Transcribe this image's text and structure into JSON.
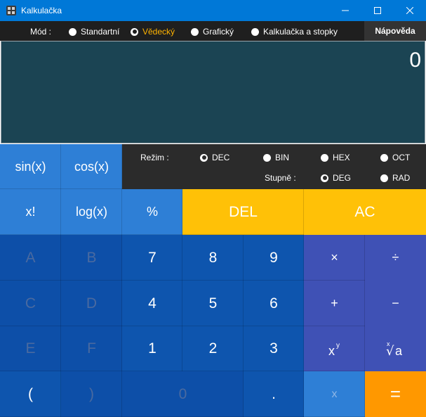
{
  "window": {
    "title": "Kalkulačka"
  },
  "modebar": {
    "label": "Mód :",
    "options": [
      "Standartní",
      "Vědecký",
      "Grafický",
      "Kalkulačka a stopky"
    ],
    "selected": "Vědecký",
    "help_label": "Nápověda"
  },
  "display": {
    "value": "0"
  },
  "regime": {
    "label": "Režim :",
    "options": [
      "DEC",
      "BIN",
      "HEX",
      "OCT"
    ],
    "selected": "DEC"
  },
  "degrees": {
    "label": "Stupně :",
    "options": [
      "DEG",
      "RAD"
    ],
    "selected": "DEG"
  },
  "keys": {
    "sin": "sin(x)",
    "cos": "cos(x)",
    "fact": "x!",
    "log": "log(x)",
    "percent": "%",
    "del": "DEL",
    "ac": "AC",
    "A": "A",
    "B": "B",
    "C": "C",
    "D": "D",
    "E": "E",
    "F": "F",
    "d7": "7",
    "d8": "8",
    "d9": "9",
    "d4": "4",
    "d5": "5",
    "d6": "6",
    "d1": "1",
    "d2": "2",
    "d3": "3",
    "d0": "0",
    "lparen": "(",
    "rparen": ")",
    "dot": ".",
    "multiply": "×",
    "divide": "÷",
    "plus": "+",
    "minus": "−",
    "x": "x",
    "equals": "="
  },
  "colors": {
    "titlebar": "#0078d7",
    "function_key": "#2e7fd6",
    "number_key": "#0d4fa8",
    "operator_key": "#3f51b5",
    "delete_key": "#ffc107",
    "equals_key": "#ff9800",
    "display": "#1b4453",
    "selected_mode_text": "#ffb300"
  }
}
